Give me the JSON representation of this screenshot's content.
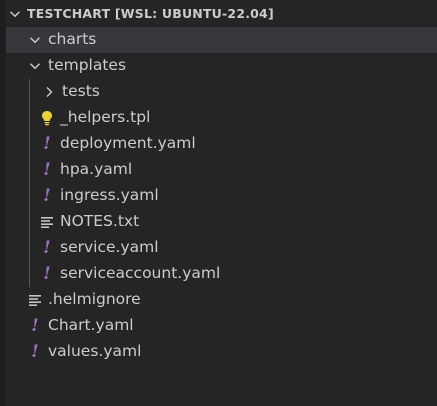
{
  "explorer": {
    "title": "TESTCHART [WSL: UBUNTU-22.04]"
  },
  "tree": {
    "charts": "charts",
    "templates": "templates",
    "tests": "tests",
    "helpers": "_helpers.tpl",
    "deployment": "deployment.yaml",
    "hpa": "hpa.yaml",
    "ingress": "ingress.yaml",
    "notes": "NOTES.txt",
    "service": "service.yaml",
    "serviceaccount": "serviceaccount.yaml",
    "helmignore": ".helmignore",
    "chart": "Chart.yaml",
    "values": "values.yaml"
  },
  "icons": {
    "yaml": "!",
    "yaml_color": "#a074c4",
    "helpers_color": "#e6d33b",
    "text_lines_color": "#c5c5c5"
  }
}
